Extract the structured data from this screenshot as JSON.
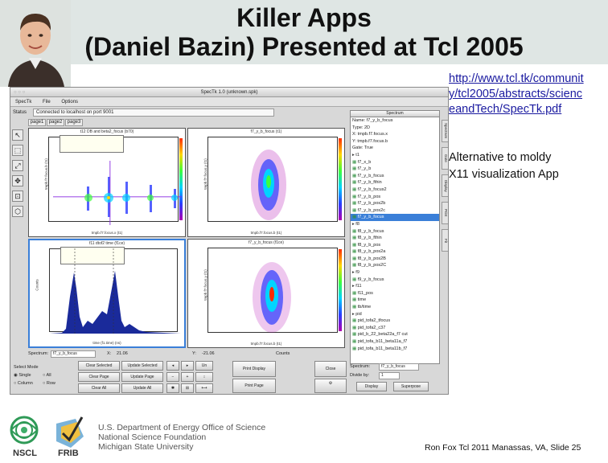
{
  "slide": {
    "title_line1": "Killer Apps",
    "title_line2": "(Daniel Bazin) Presented at Tcl 2005",
    "link_lines": [
      "http://www.tcl.tk/communit",
      "y/tcl2005/abstracts/scienc",
      "eandTech/SpecTk.pdf"
    ],
    "note_lines": [
      "Alternative to moldy",
      "X11 visualization App"
    ],
    "footer": "Ron Fox Tcl 2011 Manassas, VA, Slide 25",
    "org_lines": [
      "U.S. Department of Energy Office of Science",
      "National Science Foundation",
      "Michigan State University"
    ],
    "logos": {
      "nscl": "NSCL",
      "frib": "FRIB"
    }
  },
  "app": {
    "window_title": "SpecTk 1.0 (unknown.spk)",
    "menu": [
      "SpecTk",
      "File",
      "Options"
    ],
    "status_label": "Status",
    "status_text": "Connected to localhost on port 9001",
    "page_tabs": [
      "page1",
      "page2",
      "page3"
    ],
    "spectrum_header": "Spectrum",
    "spectrum_info": [
      "Name: f7_y_b_focus",
      "Type: 2D",
      "X: tmpb.f7.focus.x",
      "Y: tmpb.f7.focus.b",
      "Gate: True"
    ],
    "tree_items": [
      "t1",
      "f7_x_b",
      "f7_y_b",
      "f7_y_b_focus",
      "f7_y_b_fthin",
      "f7_y_b_focus2",
      "f7_y_b_pos",
      "f7_y_b_pos2b",
      "f7_y_b_pos2c",
      "f7_y_b_focus",
      "f8",
      "f8_y_b_focus",
      "f8_y_b_fthin",
      "f8_y_b_pos",
      "f8_y_b_pos2a",
      "f8_y_b_pos2B",
      "f8_y_b_pos2C",
      "f9",
      "f9_y_b_focus",
      "f11",
      "f11_pos",
      "time",
      "tb/time",
      "pid",
      "pid_tofa2_tfocus",
      "pid_tofa2_c37",
      "pid_b_22_beta22a_f7 cut",
      "pid_tofa_b11_beta11a_f7",
      "pid_tofa_b11_beta11b_f7"
    ],
    "selected_index": 9,
    "vtabs": [
      "Spectrum",
      "Gate",
      "Display",
      "Print",
      "Fit"
    ],
    "plots": [
      {
        "title": "t12 DB and beta2_focus (b70)",
        "xlabel": "tmpb.f7.focus.x (t1)",
        "ylabel": "tmpb.f7.focus.b (t1)"
      },
      {
        "title": "f7_y_b_focus (t1)",
        "xlabel": "tmpb.f7.focus.b (t1)",
        "ylabel": "tmpb.f7.focus.y (t1)"
      },
      {
        "title": "f11 dtof2 time (f1ce)",
        "xlabel": "time (f1.time) (ns)",
        "ylabel": "Counts"
      },
      {
        "title": "f7_y_b_focus (f1ce)",
        "xlabel": "tmpb.f7.focus.b (t1)",
        "ylabel": "tmpb.f7.focus.y (t1)"
      }
    ],
    "readout": {
      "spectrum_label": "Spectrum:",
      "spectrum_value": "f7_y_b_focus",
      "x_label": "X:",
      "x_value": "21.06",
      "y_label": "Y:",
      "y_value": "-21.06",
      "counts_label": "Counts"
    },
    "select_mode": {
      "label": "Select Mode",
      "options": [
        "Single",
        "All",
        "Column",
        "Row"
      ]
    },
    "buttons": {
      "clear_selected": "Clear Selected",
      "update_selected": "Update Selected",
      "clear_page": "Clear Page",
      "update_page": "Update Page",
      "clear_all": "Clear All",
      "update_all": "Update All",
      "zoom_out": "Un",
      "print_display": "Print Display",
      "print_page": "Print Page",
      "close": "Close",
      "display": "Display",
      "superpose": "Superpose"
    },
    "right_fields": {
      "spectrum_label": "Spectrum:",
      "spectrum_value": "f7_y_b_focus",
      "divide_label": "Divide by:",
      "divide_value": "1"
    }
  }
}
